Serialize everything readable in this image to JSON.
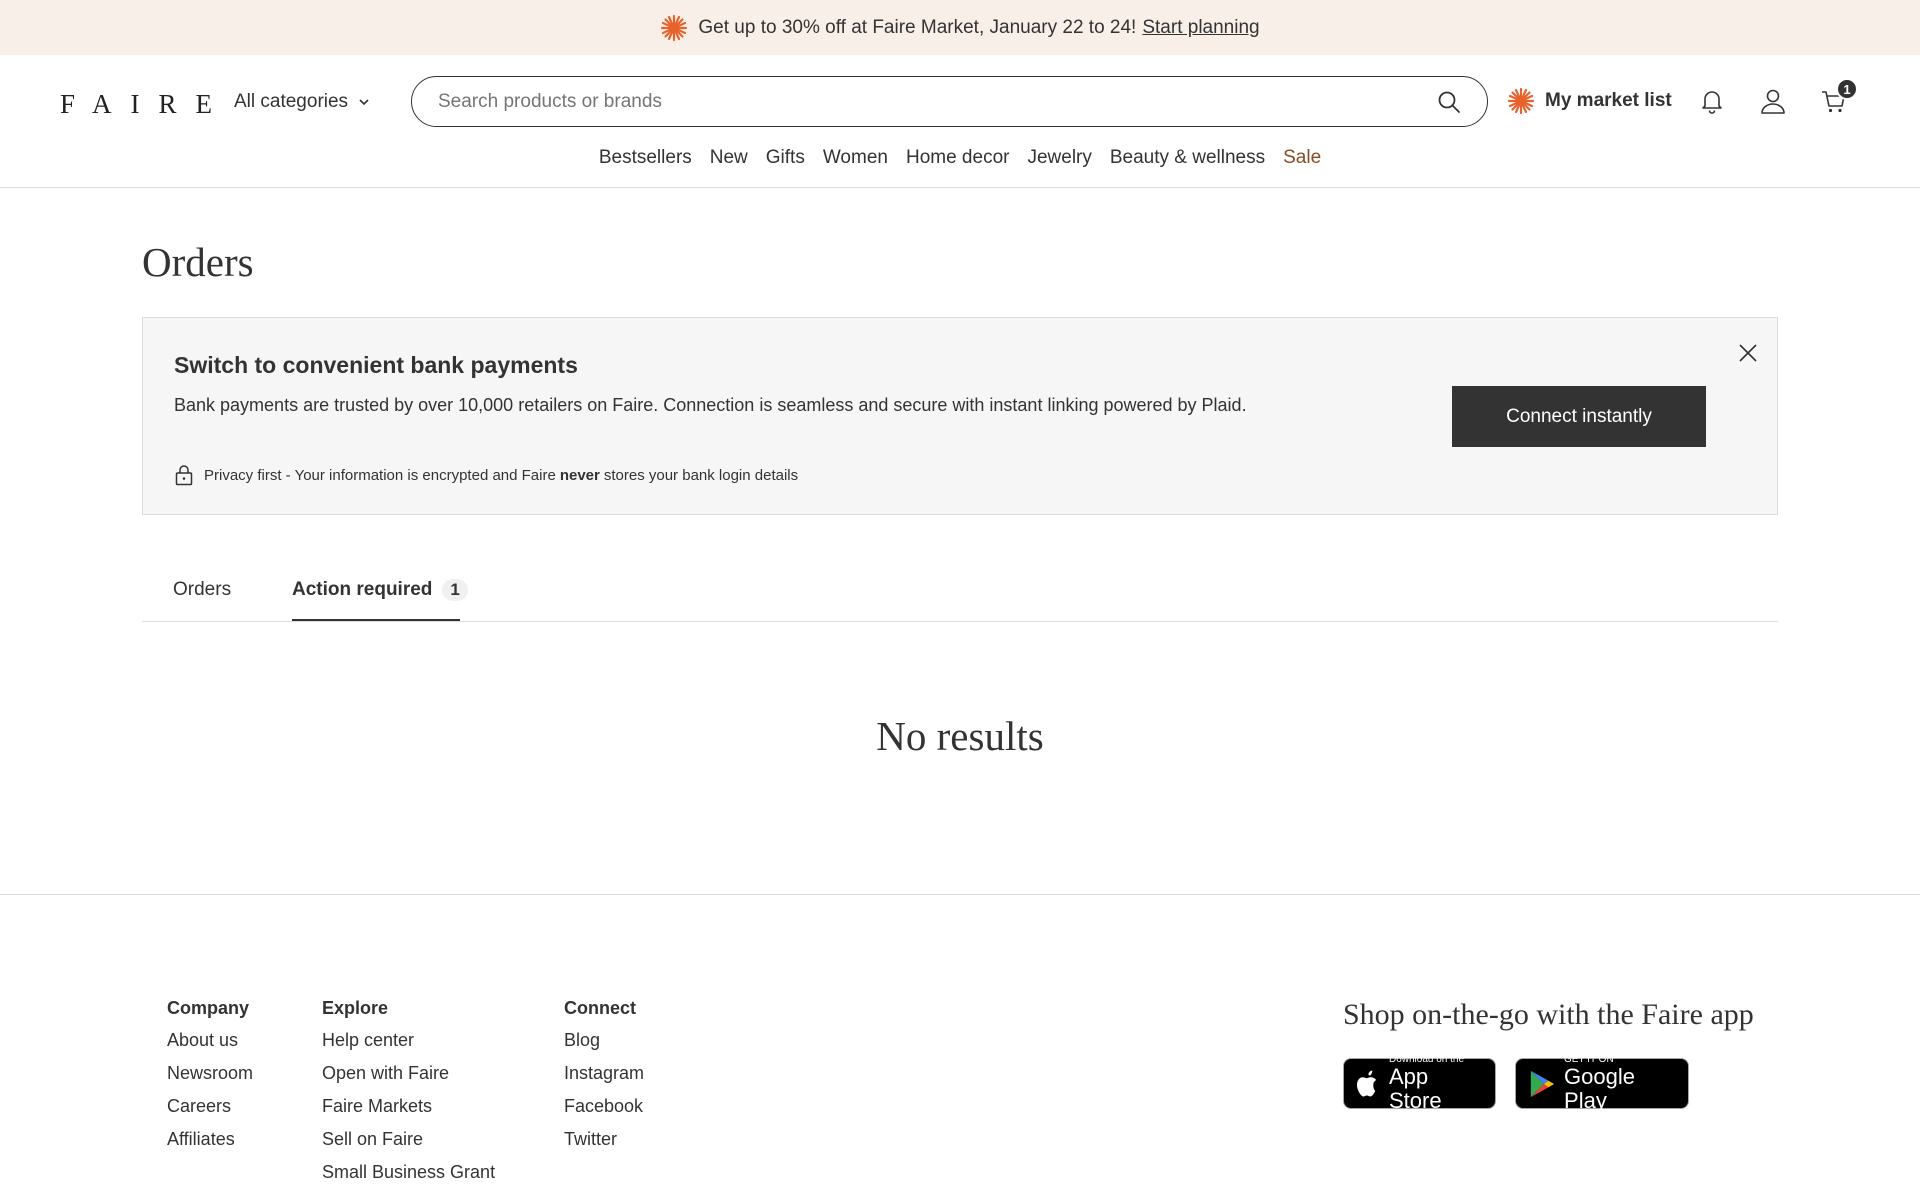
{
  "promo": {
    "text": "Get up to 30% off at Faire Market, January 22 to 24!",
    "link": "Start planning"
  },
  "header": {
    "logo": "FAIRE",
    "all_categories": "All categories",
    "search_placeholder": "Search products or brands",
    "market_list": "My market list",
    "cart_count": "1",
    "nav": [
      "Bestsellers",
      "New",
      "Gifts",
      "Women",
      "Home decor",
      "Jewelry",
      "Beauty & wellness",
      "Sale"
    ]
  },
  "page": {
    "title": "Orders"
  },
  "bank_banner": {
    "title": "Switch to convenient bank payments",
    "description": "Bank payments are trusted by over 10,000 retailers on Faire. Connection is seamless and secure with instant linking powered by Plaid.",
    "privacy_before": "Privacy first - Your information is encrypted and Faire",
    "privacy_bold": "never",
    "privacy_after": "stores your bank login details",
    "cta": "Connect instantly"
  },
  "tabs": {
    "orders": "Orders",
    "action_required": "Action required",
    "action_required_count": "1"
  },
  "empty_state": "No results",
  "footer": {
    "company": {
      "heading": "Company",
      "items": [
        "About us",
        "Newsroom",
        "Careers",
        "Affiliates"
      ]
    },
    "explore": {
      "heading": "Explore",
      "items": [
        "Help center",
        "Open with Faire",
        "Faire Markets",
        "Sell on Faire",
        "Small Business Grant"
      ]
    },
    "connect": {
      "heading": "Connect",
      "items": [
        "Blog",
        "Instagram",
        "Facebook",
        "Twitter"
      ]
    },
    "app_heading": "Shop on-the-go with the Faire app",
    "app_store": {
      "small": "Download on the",
      "big": "App Store"
    },
    "google_play": {
      "small": "GET IT ON",
      "big": "Google Play"
    }
  },
  "colors": {
    "accent_orange": "#e8622c",
    "sale": "#8a4b24",
    "dark": "#333333",
    "promo_bg": "#f8efe8"
  }
}
